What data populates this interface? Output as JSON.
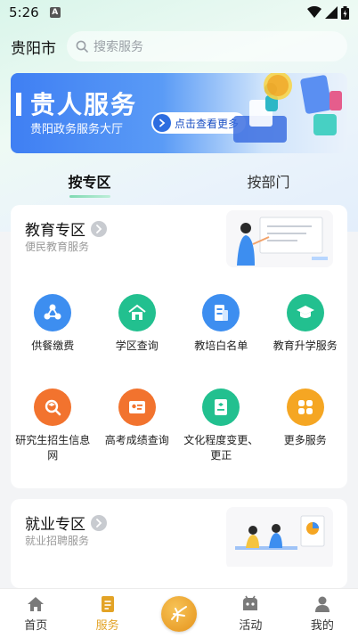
{
  "status_bar": {
    "time": "5:26",
    "notif_badge": "A"
  },
  "header": {
    "city": "贵阳市",
    "search_placeholder": "搜索服务"
  },
  "banner": {
    "title": "贵人服务",
    "subtitle": "贵阳政务服务大厅",
    "button_label": "点击查看更多"
  },
  "tabs": [
    {
      "label": "按专区",
      "active": true
    },
    {
      "label": "按部门",
      "active": false
    }
  ],
  "education": {
    "title": "教育专区",
    "subtitle": "便民教育服务",
    "items": [
      {
        "label": "供餐缴费",
        "icon": "meal-payment-icon",
        "color": "#3d8ef0"
      },
      {
        "label": "学区查询",
        "icon": "school-district-icon",
        "color": "#22c08f"
      },
      {
        "label": "教培白名单",
        "icon": "whitelist-icon",
        "color": "#3d8ef0"
      },
      {
        "label": "教育升学服务",
        "icon": "graduation-cap-icon",
        "color": "#22c08f"
      },
      {
        "label": "研究生招生信息网",
        "icon": "magnifier-icon",
        "color": "#f2732e"
      },
      {
        "label": "高考成绩查询",
        "icon": "id-card-icon",
        "color": "#f2732e"
      },
      {
        "label": "文化程度变更、更正",
        "icon": "document-edit-icon",
        "color": "#22c08f"
      },
      {
        "label": "更多服务",
        "icon": "more-grid-icon",
        "color": "#f5a623"
      }
    ]
  },
  "employment": {
    "title": "就业专区",
    "subtitle": "就业招聘服务"
  },
  "navbar": [
    {
      "label": "首页",
      "icon": "home-icon",
      "active": false
    },
    {
      "label": "服务",
      "icon": "service-icon",
      "active": true
    },
    {
      "label": "",
      "icon": "center-logo-icon",
      "active": false
    },
    {
      "label": "活动",
      "icon": "activity-icon",
      "active": false
    },
    {
      "label": "我的",
      "icon": "profile-icon",
      "active": false
    }
  ],
  "colors": {
    "accent": "#e3a326",
    "green": "#22c08f",
    "blue": "#3d8ef0",
    "orange": "#f2732e"
  }
}
